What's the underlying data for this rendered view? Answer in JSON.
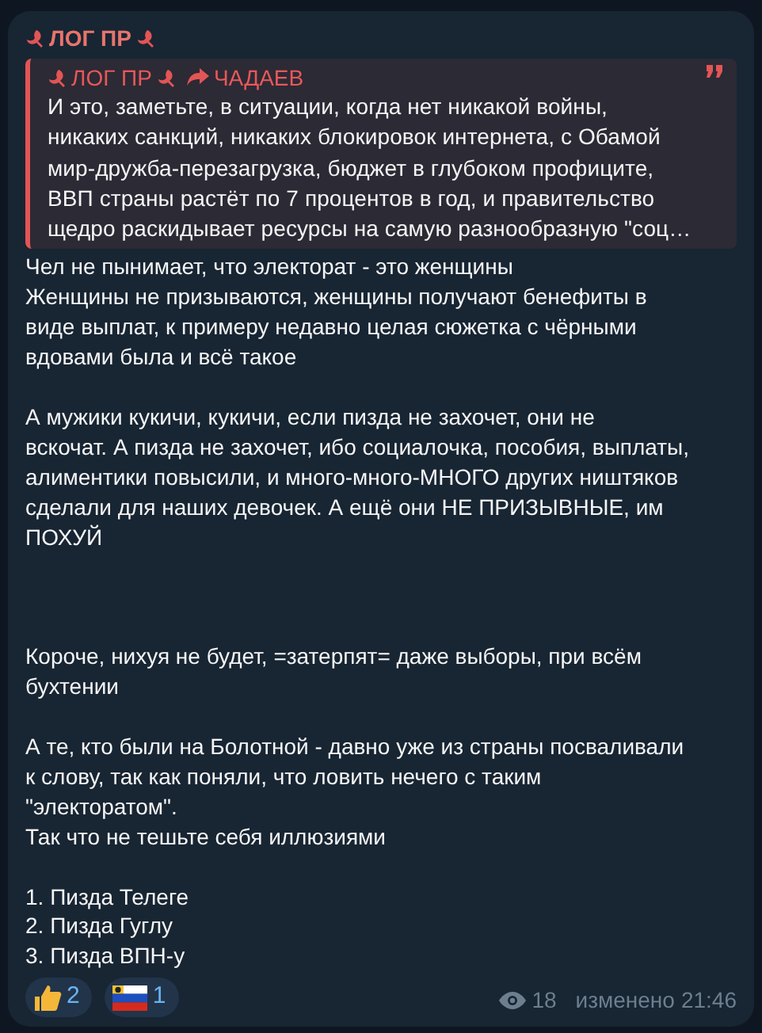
{
  "message": {
    "author": "ЛОГ ПР",
    "quote": {
      "author": "ЛОГ ПР",
      "source": "ЧАДАЕВ",
      "text": "И это, заметьте, в ситуации, когда нет никакой войны,\nникаких санкций, никаких блокировок интернета, с Обамой\nмир-дружба-перезагрузка, бюджет в глубоком профиците,\nВВП страны растёт по 7 процентов в год, и правительство\nщедро раскидывает ресурсы на самую разнообразную \"соц…"
    },
    "text": "Чел не пынимает, что электорат - это женщины\nЖенщины не призываются, женщины получают бенефиты в\nвиде выплат, к примеру недавно целая сюжетка с чёрными\nвдовами была и всё такое\n\nА мужики кукичи, кукичи, если пизда не захочет, они не\nвскочат. А пизда не захочет, ибо социалочка, пособия, выплаты,\nалиментики повысили, и много-много-МНОГО других ништяков\nсделали для наших девочек. А ещё они НЕ ПРИЗЫВНЫЕ, им\nПОХУЙ\n\n\n\nКороче, нихуя не будет, =затерпят= даже выборы, при всём\nбухтении\n\nА те, кто были на Болотной - давно уже из страны посваливали\nк слову, так как поняли, что ловить нечего с таким\n\"электоратом\".\nТак что не тешьте себя иллюзиями\n\n1. Пизда Телеге\n2. Пизда Гуглу\n3. Пизда ВПН-у",
    "reactions": [
      {
        "kind": "thumbs",
        "count": "2"
      },
      {
        "kind": "flag",
        "count": "1"
      }
    ],
    "views": "18",
    "edited": "изменено",
    "time": "21:46"
  }
}
